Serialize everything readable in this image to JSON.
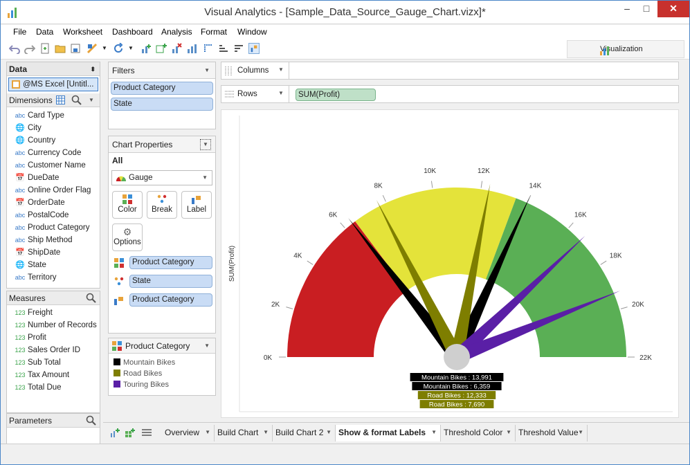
{
  "window": {
    "title": "Visual Analytics - [Sample_Data_Source_Gauge_Chart.vizx]*",
    "min": "–",
    "max": "□",
    "close": "✕"
  },
  "menu": [
    "File",
    "Data",
    "Worksheet",
    "Dashboard",
    "Analysis",
    "Format",
    "Window"
  ],
  "toolbar": {
    "visualization_label": "Visualization"
  },
  "data_panel": {
    "title": "Data",
    "source": "@MS Excel [Untitl...",
    "dimensions_title": "Dimensions",
    "dimensions": [
      {
        "type": "abc",
        "label": "Card Type"
      },
      {
        "type": "geo",
        "label": "City"
      },
      {
        "type": "geo",
        "label": "Country"
      },
      {
        "type": "abc",
        "label": "Currency Code"
      },
      {
        "type": "abc",
        "label": "Customer Name"
      },
      {
        "type": "date",
        "label": "DueDate"
      },
      {
        "type": "abc",
        "label": "Online Order Flag"
      },
      {
        "type": "date",
        "label": "OrderDate"
      },
      {
        "type": "abc",
        "label": "PostalCode"
      },
      {
        "type": "abc",
        "label": "Product Category"
      },
      {
        "type": "abc",
        "label": "Ship Method"
      },
      {
        "type": "date",
        "label": "ShipDate"
      },
      {
        "type": "geo",
        "label": "State"
      },
      {
        "type": "abc",
        "label": "Territory"
      }
    ],
    "measures_title": "Measures",
    "measures": [
      "Freight",
      "Number of Records",
      "Profit",
      "Sales Order ID",
      "Sub Total",
      "Tax Amount",
      "Total Due"
    ],
    "parameters_title": "Parameters"
  },
  "filters": {
    "title": "Filters",
    "items": [
      "Product Category",
      "State"
    ]
  },
  "chart_properties": {
    "title": "Chart Properties",
    "all_label": "All",
    "chart_type": "Gauge",
    "buttons": [
      "Color",
      "Break",
      "Label",
      "Options"
    ],
    "color_field": "Product Category",
    "break_field": "State",
    "label_field": "Product Category"
  },
  "legend": {
    "title": "Product Category",
    "items": [
      {
        "label": "Mountain Bikes",
        "color": "#000000"
      },
      {
        "label": "Road Bikes",
        "color": "#7e7e00"
      },
      {
        "label": "Touring Bikes",
        "color": "#5a1fa6"
      }
    ]
  },
  "shelves": {
    "columns_label": "Columns",
    "rows_label": "Rows",
    "rows_pill": "SUM(Profit)"
  },
  "chart_data": {
    "type": "gauge",
    "ylabel": "SUM(Profit)",
    "range": [
      0,
      22000
    ],
    "ticks": [
      "0K",
      "2K",
      "4K",
      "6K",
      "8K",
      "10K",
      "12K",
      "14K",
      "16K",
      "18K",
      "20K",
      "22K"
    ],
    "bands": [
      {
        "from": 0,
        "to": 6500,
        "color": "#c91e22"
      },
      {
        "from": 6500,
        "to": 13500,
        "color": "#e4e33a"
      },
      {
        "from": 13500,
        "to": 22000,
        "color": "#5aaf55"
      }
    ],
    "needles": [
      {
        "category": "Mountain Bikes",
        "value": 13991,
        "color": "#000000",
        "label": "Mountain Bikes : 13,991"
      },
      {
        "category": "Mountain Bikes",
        "value": 6359,
        "color": "#000000",
        "label": "Mountain Bikes : 6,359"
      },
      {
        "category": "Road Bikes",
        "value": 12333,
        "color": "#7e7e00",
        "label": "Road Bikes : 12,333"
      },
      {
        "category": "Road Bikes",
        "value": 7690,
        "color": "#7e7e00",
        "label": "Road Bikes : 7,690"
      },
      {
        "category": "Touring Bikes",
        "value": 16700,
        "color": "#5a1fa6",
        "label": ""
      },
      {
        "category": "Touring Bikes",
        "value": 19300,
        "color": "#5a1fa6",
        "label": ""
      }
    ]
  },
  "tabs": [
    {
      "label": "Overview",
      "active": false
    },
    {
      "label": "Build Chart",
      "active": false
    },
    {
      "label": "Build Chart 2",
      "active": false
    },
    {
      "label": "Show & format Labels",
      "active": true
    },
    {
      "label": "Threshold Color",
      "active": false
    },
    {
      "label": "Threshold Value",
      "active": false
    }
  ]
}
